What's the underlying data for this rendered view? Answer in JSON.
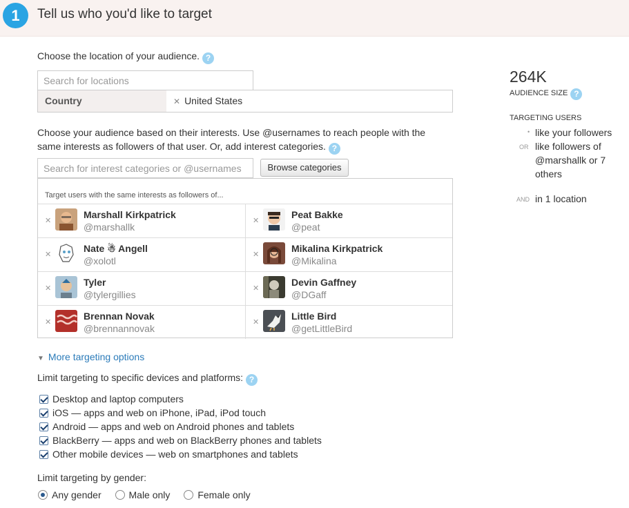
{
  "header": {
    "step": "1",
    "title": "Tell us who you'd like to target"
  },
  "location": {
    "label": "Choose the location of your audience.",
    "search_placeholder": "Search for locations",
    "type_label": "Country",
    "selected": "United States"
  },
  "interests": {
    "label_line1": "Choose your audience based on their interests. Use @usernames to reach people with the",
    "label_line2": "same interests as followers of that user. Or, add interest categories.",
    "search_placeholder": "Search for interest categories or @usernames",
    "browse_label": "Browse categories",
    "caption": "Target users with the same interests as followers of...",
    "users": [
      {
        "name": "Marshall Kirkpatrick",
        "handle": "@marshallk",
        "avatar_color": "#a06a3b"
      },
      {
        "name": "Peat Bakke",
        "handle": "@peat",
        "avatar_color": "#e8e8e8"
      },
      {
        "name": "Nate ☃ Angell",
        "handle": "@xolotl",
        "avatar_color": "#dfe8ec"
      },
      {
        "name": "Mikalina Kirkpatrick",
        "handle": "@Mikalina",
        "avatar_color": "#7a4a3a"
      },
      {
        "name": "Tyler",
        "handle": "@tylergillies",
        "avatar_color": "#9bb6cc"
      },
      {
        "name": "Devin Gaffney",
        "handle": "@DGaff",
        "avatar_color": "#5a5a4a"
      },
      {
        "name": "Brennan Novak",
        "handle": "@brennannovak",
        "avatar_color": "#b3302a"
      },
      {
        "name": "Little Bird",
        "handle": "@getLittleBird",
        "avatar_color": "#4b4f54"
      }
    ]
  },
  "more_options": {
    "label": "More targeting options"
  },
  "devices": {
    "label": "Limit targeting to specific devices and platforms:",
    "options": [
      "Desktop and laptop computers",
      "iOS — apps and web on iPhone, iPad, iPod touch",
      "Android — apps and web on Android phones and tablets",
      "BlackBerry — apps and web on BlackBerry phones and tablets",
      "Other mobile devices — web on smartphones and tablets"
    ]
  },
  "gender": {
    "label": "Limit targeting by gender:",
    "options": [
      "Any gender",
      "Male only",
      "Female only"
    ],
    "selected": "Any gender"
  },
  "summary": {
    "audience_size": "264K",
    "audience_label": "AUDIENCE SIZE",
    "targeting_label": "TARGETING USERS",
    "line1": "like your followers",
    "or": "OR",
    "line2": "like followers of",
    "line3": "@marshallk or 7",
    "line4": "others",
    "and": "AND",
    "line5": "in 1 location"
  }
}
